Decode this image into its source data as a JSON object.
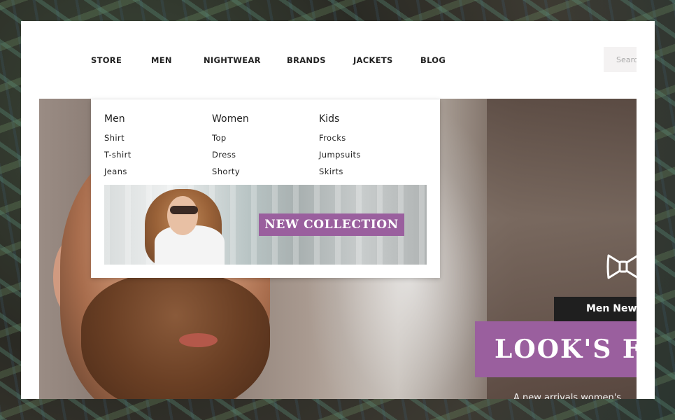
{
  "nav": {
    "items": [
      {
        "label": "STORE"
      },
      {
        "label": "MEN"
      },
      {
        "label": "NIGHTWEAR"
      },
      {
        "label": "BRANDS"
      },
      {
        "label": "JACKETS"
      },
      {
        "label": "BLOG"
      }
    ]
  },
  "search": {
    "placeholder": "Search"
  },
  "mega_menu": {
    "columns": [
      {
        "title": "Men",
        "links": [
          "Shirt",
          "T-shirt",
          "Jeans"
        ]
      },
      {
        "title": "Women",
        "links": [
          "Top",
          "Dress",
          "Shorty"
        ]
      },
      {
        "title": "Kids",
        "links": [
          "Frocks",
          "Jumpsuits",
          "Skirts"
        ]
      }
    ],
    "banner": {
      "button_label": "NEW COLLECTION"
    }
  },
  "hero": {
    "tag": "Men New",
    "title": "LOOK'S FO",
    "subtitle": "A new arrivals women's"
  },
  "colors": {
    "accent": "#9a5f9e",
    "dark": "#1f1f1f"
  },
  "icons": {
    "hero": "bowtie-icon"
  }
}
